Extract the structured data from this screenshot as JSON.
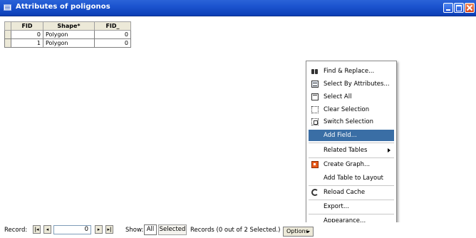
{
  "window": {
    "title": "Attributes of poligonos",
    "icon": "table-icon"
  },
  "table": {
    "columns": [
      "FID",
      "Shape*",
      "FID_"
    ],
    "rows": [
      {
        "fid": "0",
        "shape": "Polygon",
        "fid_": "0"
      },
      {
        "fid": "1",
        "shape": "Polygon",
        "fid_": "0"
      }
    ]
  },
  "menu": {
    "items": [
      {
        "label": "Find & Replace...",
        "icon": "binoculars-icon"
      },
      {
        "label": "Select By Attributes...",
        "icon": "sql-icon"
      },
      {
        "label": "Select All",
        "icon": "select-all-icon"
      },
      {
        "label": "Clear Selection",
        "icon": "clear-selection-icon"
      },
      {
        "label": "Switch Selection",
        "icon": "switch-selection-icon"
      },
      {
        "label": "Add Field...",
        "highlighted": true
      },
      {
        "label": "Related Tables",
        "submenu": true
      },
      {
        "label": "Create Graph...",
        "icon": "graph-icon"
      },
      {
        "label": "Add Table to Layout"
      },
      {
        "label": "Reload Cache",
        "icon": "reload-icon"
      },
      {
        "label": "Export..."
      },
      {
        "label": "Appearance..."
      }
    ]
  },
  "statusbar": {
    "record_label": "Record:",
    "record_value": "0",
    "show_label": "Show:",
    "all_label": "All",
    "selected_label": "Selected",
    "records_text": "Records  (0 out of 2 Selected.)",
    "options_label": "Options"
  },
  "colors": {
    "titlebar": "#1c54cf",
    "highlight": "#3a6ea5",
    "close_button": "#d6441b"
  }
}
